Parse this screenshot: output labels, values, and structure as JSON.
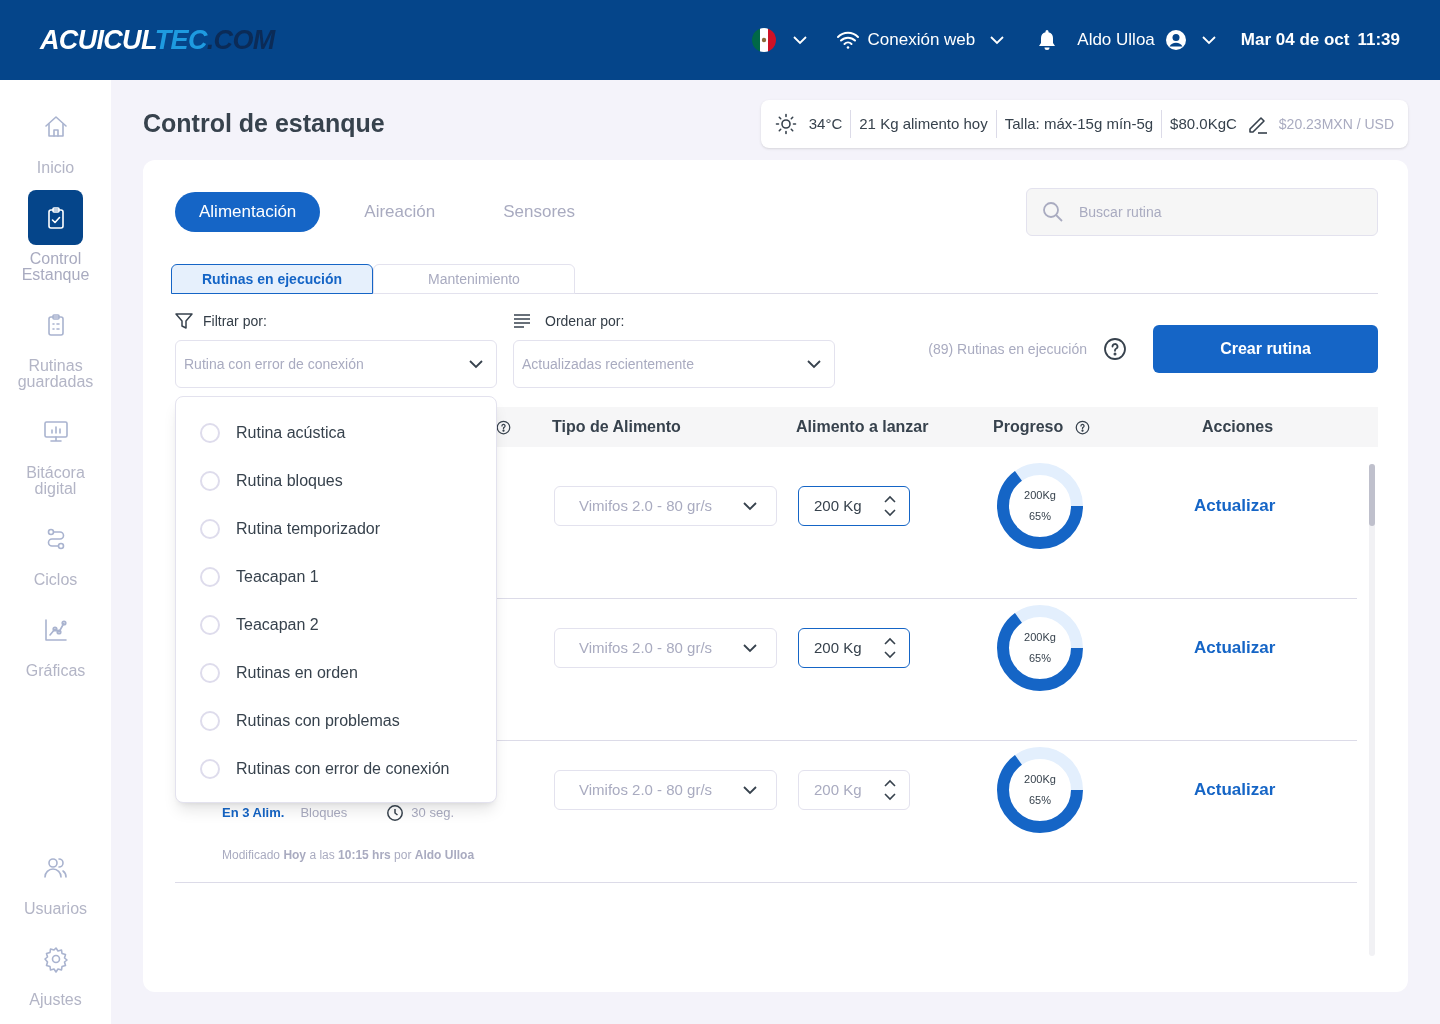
{
  "header": {
    "logo": [
      {
        "text": "ACUICUL"
      },
      {
        "text": "TEC"
      },
      {
        "text": ".COM"
      }
    ],
    "connection": "Conexión web",
    "user": "Aldo Ulloa",
    "date": "Mar 04 de oct",
    "time": "11:39"
  },
  "sidebar": {
    "items": [
      {
        "label": "Inicio",
        "selected": false
      },
      {
        "label": "Control Estanque",
        "selected": true
      },
      {
        "label": "Rutinas guardadas",
        "selected": false
      },
      {
        "label": "Bitácora digital",
        "selected": false
      },
      {
        "label": "Ciclos",
        "selected": false
      },
      {
        "label": "Gráficas",
        "selected": false
      }
    ],
    "bottom_items": [
      {
        "label": "Usuarios",
        "selected": false
      },
      {
        "label": "Ajustes",
        "selected": false
      }
    ]
  },
  "page_title": "Control de estanque",
  "stats": {
    "temperature": "34°C",
    "feed_today": "21 Kg alimento hoy",
    "size": "Talla: máx-15g mín-5g",
    "price": "$80.0KgC",
    "exchange": "$20.23MXN / USD"
  },
  "main_tabs": [
    {
      "label": "Alimentación",
      "selected": true
    },
    {
      "label": "Aireación",
      "selected": false
    },
    {
      "label": "Sensores",
      "selected": false
    }
  ],
  "search": {
    "placeholder": "Buscar rutina"
  },
  "sub_tabs": [
    {
      "label": "Rutinas en ejecución",
      "selected": true
    },
    {
      "label": "Mantenimiento",
      "selected": false
    }
  ],
  "filter": {
    "label": "Filtrar por:",
    "value": "Rutina con error de conexión",
    "expanded": true,
    "options": [
      {
        "label": "Rutina acústica",
        "selected": false
      },
      {
        "label": "Rutina bloques",
        "selected": false
      },
      {
        "label": "Rutina temporizador",
        "selected": false
      },
      {
        "label": "Teacapan 1",
        "selected": false
      },
      {
        "label": "Teacapan 2",
        "selected": false
      },
      {
        "label": "Rutinas en orden",
        "selected": false
      },
      {
        "label": "Rutinas con problemas",
        "selected": false
      },
      {
        "label": "Rutinas con error de conexión",
        "selected": false
      }
    ]
  },
  "sort": {
    "label": "Ordenar por:",
    "value": "Actualizadas recientemente"
  },
  "count": "(89) Rutinas en ejecución",
  "create_button": "Crear rutina",
  "table": {
    "columns": [
      {
        "help": true
      },
      {
        "label": "Tipo de Alimento",
        "help": false
      },
      {
        "label": "Alimento a lanzar",
        "help": false
      },
      {
        "label": "Progreso",
        "help": true
      },
      {
        "label": "Acciones",
        "help": false
      }
    ],
    "rows": [
      {
        "feed_type": "Vimifos 2.0 - 80 gr/s",
        "amount": "200 Kg",
        "editable": true,
        "progress_amount": "200Kg",
        "progress_percent": "65%",
        "level": 0.65,
        "action": "Actualizar"
      },
      {
        "feed_type": "Vimifos 2.0 - 80 gr/s",
        "amount": "200 Kg",
        "editable": true,
        "progress_amount": "200Kg",
        "progress_percent": "65%",
        "level": 0.65,
        "action": "Actualizar"
      },
      {
        "feed_type": "Vimifos 2.0 - 80 gr/s",
        "amount": "200 Kg",
        "editable": false,
        "progress_amount": "200Kg",
        "progress_percent": "65%",
        "level": 0.65,
        "action": "Actualizar",
        "details": {
          "feeds": "En 3 Alim.",
          "mode": "Bloques",
          "interval": "30 seg.",
          "modified": "Modificado **Hoy** a las **10:15 hrs** por **Aldo Ulloa**"
        }
      }
    ]
  }
}
